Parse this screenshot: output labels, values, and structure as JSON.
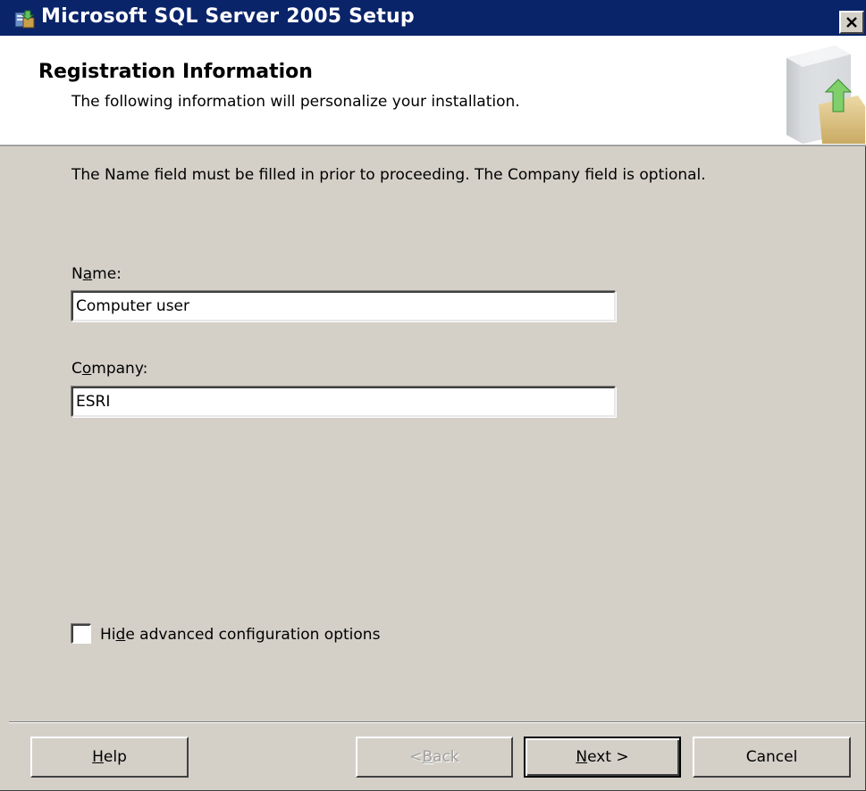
{
  "window": {
    "title": "Microsoft SQL Server 2005 Setup"
  },
  "header": {
    "title": "Registration Information",
    "subtitle": "The following information will personalize your installation."
  },
  "body": {
    "instructions": "The Name field must be filled in prior to proceeding. The Company field is optional.",
    "name_label_pre": "N",
    "name_label_mn": "a",
    "name_label_post": "me:",
    "name_value": "Computer user",
    "company_label_pre": "C",
    "company_label_mn": "o",
    "company_label_post": "mpany:",
    "company_value": "ESRI",
    "checkbox_label_pre": "Hi",
    "checkbox_label_mn": "d",
    "checkbox_label_post": "e advanced configuration options",
    "checkbox_checked": false
  },
  "buttons": {
    "help_mn": "H",
    "help_rest": "elp",
    "back_pre": "< ",
    "back_mn": "B",
    "back_post": "ack",
    "next_mn": "N",
    "next_post": "ext >",
    "cancel": "Cancel"
  },
  "colors": {
    "titlebar": "#0a246a",
    "face": "#d4d0c8",
    "header_bg": "#ffffff"
  },
  "icons": {
    "title": "setup-icon",
    "close": "close-icon",
    "header_art": "server-install-icon"
  }
}
